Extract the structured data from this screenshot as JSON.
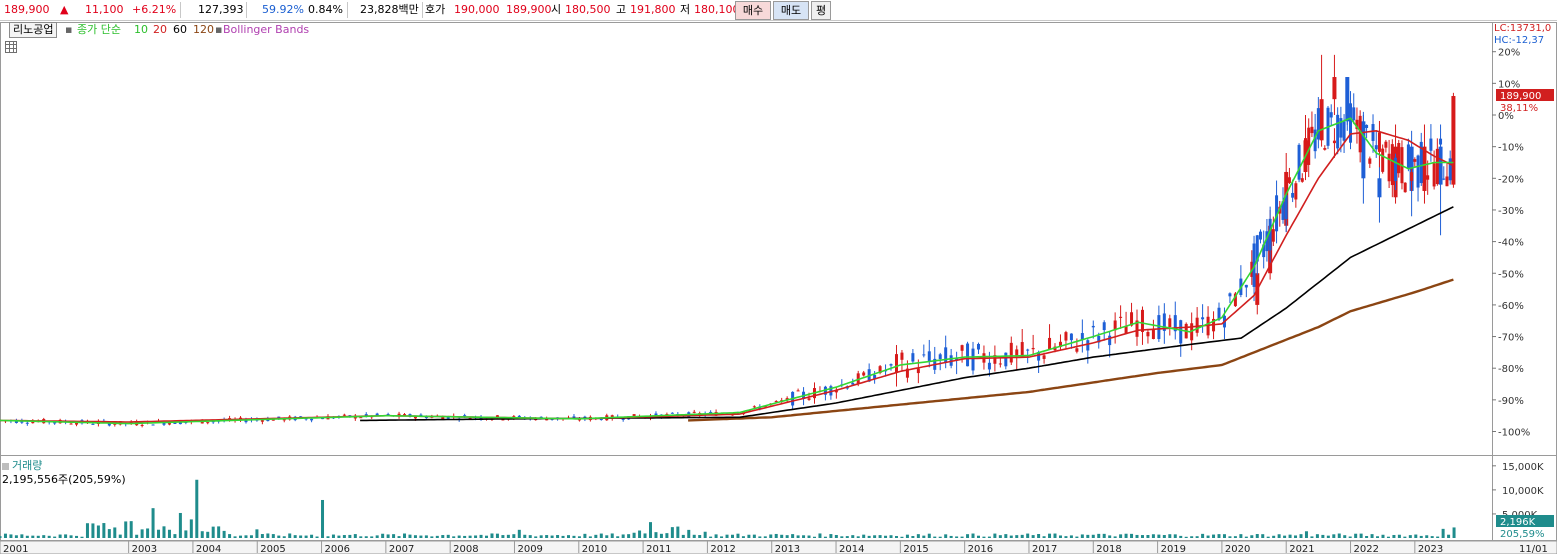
{
  "quote_bar": {
    "price": "189,900",
    "change_arrow": "▲",
    "change": "11,100",
    "change_rate": "+6.21%",
    "volume": "127,393",
    "volume_ratio": "59.92%",
    "turnover_ratio": "0.84%",
    "amount": "23,828백만",
    "bid_label": "호가",
    "bid_ask": "190,000",
    "bid_bid": "189,900",
    "open_label": "시",
    "open": "180,500",
    "high_label": "고",
    "high": "191,800",
    "low_label": "저",
    "low": "180,100",
    "buy_button": "매수",
    "sell_button": "매도",
    "flat_button": "평"
  },
  "legend": {
    "stock_name": "리노공업",
    "ma_title": "종가 단순",
    "ma10": "10",
    "ma20": "20",
    "ma60": "60",
    "ma120": "120",
    "bollinger": "Bollinger Bands"
  },
  "right_panel": {
    "lc": "LC:13731,0",
    "hc": "HC:-12,37",
    "price_badge": "189,900",
    "price_pct": "38,11%",
    "volume_badge": "2,196K",
    "volume_pct": "205,59%"
  },
  "volume_panel": {
    "title": "거래량",
    "value": "2,195,556주(205,59%)"
  },
  "colors": {
    "up": "#d71a1a",
    "down": "#1e5fd6",
    "ma10": "#33d633",
    "ma20": "#d11f1f",
    "ma60": "#000000",
    "ma120": "#8b4513",
    "volume": "#1f8c8c",
    "legend_ma10": "#2cbf2c",
    "legend_ma20": "#d11f1f",
    "legend_ma120": "#8b4513",
    "legend_bollinger": "#b03fb0"
  },
  "chart_data": {
    "type": "candlestick",
    "x_label_years": [
      "2001",
      "2003",
      "2004",
      "2005",
      "2006",
      "2007",
      "2008",
      "2009",
      "2010",
      "2011",
      "2012",
      "2013",
      "2014",
      "2015",
      "2016",
      "2017",
      "2018",
      "2019",
      "2020",
      "2021",
      "2022",
      "2023"
    ],
    "x_end_label": "11/01",
    "y_ticks_pct": [
      "20%",
      "10%",
      "0%",
      "-10%",
      "-20%",
      "-30%",
      "-40%",
      "-50%",
      "-60%",
      "-70%",
      "-80%",
      "-90%",
      "-100%"
    ],
    "volume_ticks": [
      "15,000K",
      "10,000K",
      "5,000K"
    ],
    "price_scale": "percent of latest close",
    "last_close": 189900,
    "last_close_pct": 38.11,
    "price_high_pct": 20,
    "ma_checkpoints_pct": {
      "ma10": [
        [
          2001.0,
          -96.5
        ],
        [
          2003.0,
          -97.5
        ],
        [
          2007.0,
          -95
        ],
        [
          2010.0,
          -96
        ],
        [
          2012.5,
          -94
        ],
        [
          2014.0,
          -86
        ],
        [
          2015.0,
          -79
        ],
        [
          2016.0,
          -76.5
        ],
        [
          2017.0,
          -76
        ],
        [
          2018.0,
          -70
        ],
        [
          2018.7,
          -65.5
        ],
        [
          2019.5,
          -68.5
        ],
        [
          2020.0,
          -64
        ],
        [
          2020.5,
          -48
        ],
        [
          2021.0,
          -25
        ],
        [
          2021.5,
          -5
        ],
        [
          2022.0,
          -1
        ],
        [
          2022.4,
          -12
        ],
        [
          2022.9,
          -17
        ],
        [
          2023.3,
          -15
        ],
        [
          2023.6,
          -15
        ]
      ],
      "ma20": [
        [
          2001.0,
          -96.5
        ],
        [
          2003.0,
          -97
        ],
        [
          2007.0,
          -95
        ],
        [
          2010.0,
          -96
        ],
        [
          2012.5,
          -94.5
        ],
        [
          2014.0,
          -87
        ],
        [
          2015.0,
          -81
        ],
        [
          2016.0,
          -77
        ],
        [
          2017.0,
          -76.5
        ],
        [
          2018.0,
          -72
        ],
        [
          2018.7,
          -68
        ],
        [
          2019.5,
          -67
        ],
        [
          2020.0,
          -66
        ],
        [
          2020.5,
          -57
        ],
        [
          2021.0,
          -38
        ],
        [
          2021.5,
          -20
        ],
        [
          2022.0,
          -6
        ],
        [
          2022.4,
          -5
        ],
        [
          2022.9,
          -8
        ],
        [
          2023.3,
          -13
        ],
        [
          2023.6,
          -16
        ]
      ],
      "ma60": [
        [
          2006.6,
          -96.5
        ],
        [
          2009.0,
          -96
        ],
        [
          2012.5,
          -95.5
        ],
        [
          2014.0,
          -91
        ],
        [
          2015.0,
          -87
        ],
        [
          2016.0,
          -83
        ],
        [
          2017.0,
          -80
        ],
        [
          2018.0,
          -76.5
        ],
        [
          2019.5,
          -72.5
        ],
        [
          2020.3,
          -70.5
        ],
        [
          2021.0,
          -61
        ],
        [
          2021.5,
          -53
        ],
        [
          2022.0,
          -45
        ],
        [
          2022.5,
          -40
        ],
        [
          2023.0,
          -35
        ],
        [
          2023.6,
          -29
        ]
      ],
      "ma120": [
        [
          2011.7,
          -96.5
        ],
        [
          2013.0,
          -95.5
        ],
        [
          2014.0,
          -93.5
        ],
        [
          2015.0,
          -91.5
        ],
        [
          2016.0,
          -89.5
        ],
        [
          2017.0,
          -87.5
        ],
        [
          2018.0,
          -84.5
        ],
        [
          2019.0,
          -81.5
        ],
        [
          2020.0,
          -79
        ],
        [
          2021.0,
          -71
        ],
        [
          2021.5,
          -67
        ],
        [
          2022.0,
          -62
        ],
        [
          2022.5,
          -59
        ],
        [
          2023.0,
          -56
        ],
        [
          2023.6,
          -52
        ]
      ]
    },
    "candles_pct": [
      {
        "t": 2020.55,
        "o": -60,
        "c": -50,
        "h": -45,
        "l": -63
      },
      {
        "t": 2020.75,
        "o": -50,
        "c": -35,
        "h": -30,
        "l": -52
      },
      {
        "t": 2021.0,
        "o": -35,
        "c": -18,
        "h": -12,
        "l": -37
      },
      {
        "t": 2021.3,
        "o": -18,
        "c": -8,
        "h": 0,
        "l": -20
      },
      {
        "t": 2021.55,
        "o": -8,
        "c": 5,
        "h": 19,
        "l": -10
      },
      {
        "t": 2021.75,
        "o": 5,
        "c": 12,
        "h": 19,
        "l": 0
      },
      {
        "t": 2021.95,
        "o": 12,
        "c": -2,
        "h": 12,
        "l": -5
      },
      {
        "t": 2022.2,
        "o": -2,
        "c": -20,
        "h": 0,
        "l": -28
      },
      {
        "t": 2022.45,
        "o": -20,
        "c": -26,
        "h": -12,
        "l": -34
      },
      {
        "t": 2022.7,
        "o": -26,
        "c": -10,
        "h": -3,
        "l": -28
      },
      {
        "t": 2022.95,
        "o": -10,
        "c": -24,
        "h": -5,
        "l": -32
      },
      {
        "t": 2023.15,
        "o": -24,
        "c": -10,
        "h": -3,
        "l": -28
      },
      {
        "t": 2023.4,
        "o": -10,
        "c": -22,
        "h": -3,
        "l": -38
      },
      {
        "t": 2023.6,
        "o": -22,
        "c": 6,
        "h": 7,
        "l": -23
      }
    ],
    "volume_spikes_k": [
      [
        2002.5,
        2600
      ],
      [
        2003.4,
        6200
      ],
      [
        2003.8,
        5200
      ],
      [
        2004.1,
        12100
      ],
      [
        2005.0,
        1800
      ],
      [
        2006.0,
        7900
      ],
      [
        2009.1,
        1700
      ],
      [
        2011.1,
        3300
      ],
      [
        2012.0,
        1300
      ],
      [
        2021.3,
        1400
      ],
      [
        2023.4,
        1900
      ],
      [
        2023.6,
        2196
      ]
    ]
  }
}
